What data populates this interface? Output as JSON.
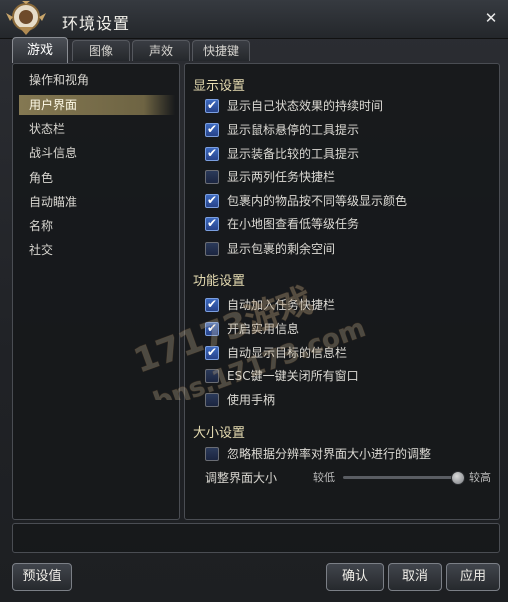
{
  "window": {
    "title": "环境设置",
    "close_glyph": "✕"
  },
  "tabs": [
    {
      "label": "游戏",
      "active": true
    },
    {
      "label": "图像",
      "active": false
    },
    {
      "label": "声效",
      "active": false
    },
    {
      "label": "快捷键",
      "active": false
    }
  ],
  "categories": [
    {
      "label": "操作和视角",
      "selected": false
    },
    {
      "label": "用户界面",
      "selected": true
    },
    {
      "label": "状态栏",
      "selected": false
    },
    {
      "label": "战斗信息",
      "selected": false
    },
    {
      "label": "角色",
      "selected": false
    },
    {
      "label": "自动瞄准",
      "selected": false
    },
    {
      "label": "名称",
      "selected": false
    },
    {
      "label": "社交",
      "selected": false
    }
  ],
  "sections": {
    "display": {
      "title": "显示设置",
      "options": [
        {
          "label": "显示自己状态效果的持续时间",
          "checked": true
        },
        {
          "label": "显示鼠标悬停的工具提示",
          "checked": true
        },
        {
          "label": "显示装备比较的工具提示",
          "checked": true
        },
        {
          "label": "显示两列任务快捷栏",
          "checked": false
        },
        {
          "label": "包裹内的物品按不同等级显示颜色",
          "checked": true
        },
        {
          "label": "在小地图查看低等级任务",
          "checked": true
        },
        {
          "label": "显示包裹的剩余空间",
          "checked": false
        }
      ]
    },
    "function": {
      "title": "功能设置",
      "options": [
        {
          "label": "自动加入任务快捷栏",
          "checked": true
        },
        {
          "label": "开启实用信息",
          "checked": true
        },
        {
          "label": "自动显示目标的信息栏",
          "checked": true
        },
        {
          "label": "ESC键一键关闭所有窗口",
          "checked": false
        },
        {
          "label": "使用手柄",
          "checked": false
        }
      ]
    },
    "size": {
      "title": "大小设置",
      "options": [
        {
          "label": "忽略根据分辨率对界面大小进行的调整",
          "checked": false
        }
      ],
      "slider": {
        "label": "调整界面大小",
        "low_label": "较低",
        "high_label": "较高",
        "value": 1.0
      }
    }
  },
  "buttons": {
    "presets": "预设值",
    "confirm": "确认",
    "cancel": "取消",
    "apply": "应用"
  },
  "colors": {
    "checkbox_checked": "#3d6ac0",
    "selected_category": "#847852",
    "section_title": "#e6dcb2"
  },
  "watermark": {
    "line1": "17173游戏",
    "line2": "bns.17173.com"
  }
}
